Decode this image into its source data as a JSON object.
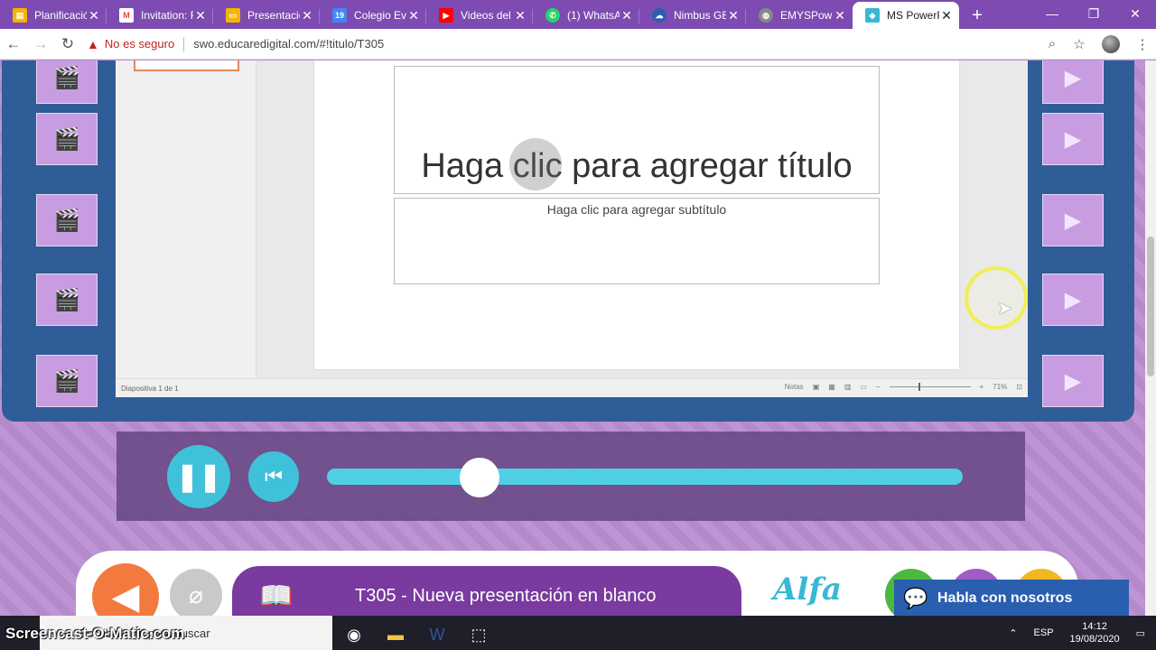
{
  "browser": {
    "tabs": [
      {
        "title": "Planificació",
        "favicon": "doc-icon",
        "color": "#f4b400"
      },
      {
        "title": "Invitation: F",
        "favicon": "gmail-icon",
        "color": "#ea4335"
      },
      {
        "title": "Presentació",
        "favicon": "slides-icon",
        "color": "#f4b400"
      },
      {
        "title": "Colegio Eve",
        "favicon": "calendar-icon",
        "color": "#4285f4"
      },
      {
        "title": "Videos del",
        "favicon": "youtube-icon",
        "color": "#ff0000"
      },
      {
        "title": "(1) WhatsA",
        "favicon": "whatsapp-icon",
        "color": "#25d366"
      },
      {
        "title": "Nimbus GE",
        "favicon": "cloud-icon",
        "color": "#2a5eae"
      },
      {
        "title": "EMYSPower",
        "favicon": "globe-icon",
        "color": "#888888"
      },
      {
        "title": "MS PowerP",
        "favicon": "slides-icon",
        "color": "#37b8d4",
        "active": true
      }
    ],
    "address": {
      "security_label": "No es seguro",
      "url": "swo.educaredigital.com/#!titulo/T305"
    }
  },
  "presentation": {
    "slide_title": "Haga clic para agregar título",
    "slide_subtitle": "Haga clic para agregar subtítulo",
    "status_left": "Diapositiva 1 de 1",
    "notes_label": "Notas",
    "zoom": "71%"
  },
  "player": {
    "progress_fraction": 0.24
  },
  "lesson": {
    "title": "T305 - Nueva presentación en blanco",
    "brand": "Alfa"
  },
  "chat": {
    "label": "Habla con nosotros"
  },
  "taskbar": {
    "search_placeholder": "Escribe aquí para buscar",
    "language": "ESP",
    "time": "14:12",
    "date": "19/08/2020",
    "watermark": "Screencast-O-Matic.com"
  },
  "colors": {
    "browser_frame": "#7d4bb1",
    "accent_cyan": "#3fc2d9",
    "viewer_blue": "#2f5d97",
    "back_orange": "#f37a3e"
  }
}
